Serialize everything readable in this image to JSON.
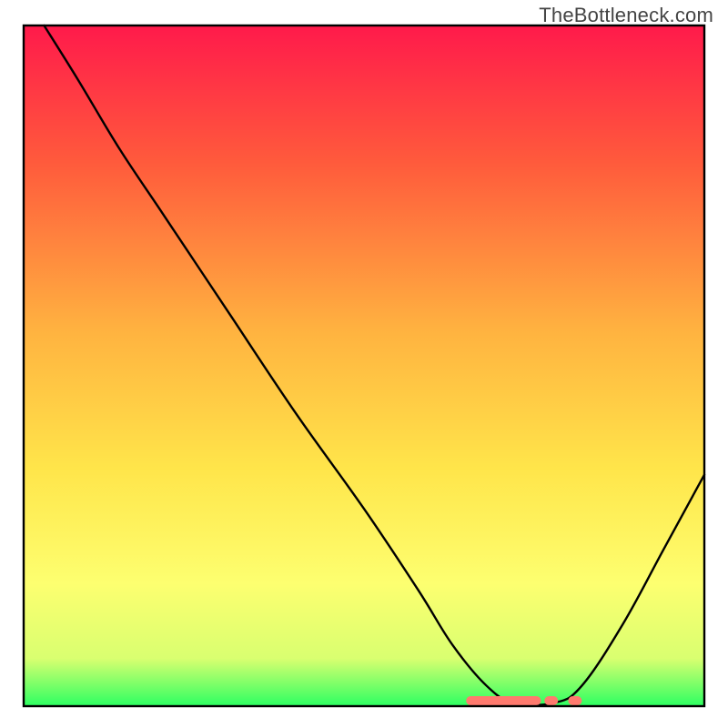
{
  "watermark": "TheBottleneck.com",
  "chart_data": {
    "type": "line",
    "title": "",
    "xlabel": "",
    "ylabel": "",
    "xlim": [
      0,
      100
    ],
    "ylim": [
      0,
      100
    ],
    "gradient_stops": [
      {
        "offset": 0.0,
        "color": "#ff1a4b"
      },
      {
        "offset": 0.2,
        "color": "#ff5a3c"
      },
      {
        "offset": 0.45,
        "color": "#ffb340"
      },
      {
        "offset": 0.65,
        "color": "#ffe54a"
      },
      {
        "offset": 0.82,
        "color": "#fdff70"
      },
      {
        "offset": 0.93,
        "color": "#d9ff70"
      },
      {
        "offset": 1.0,
        "color": "#2dff62"
      }
    ],
    "series": [
      {
        "name": "curve",
        "points": [
          {
            "x": 3.0,
            "y": 100.0
          },
          {
            "x": 8.0,
            "y": 92.0
          },
          {
            "x": 14.0,
            "y": 82.0
          },
          {
            "x": 20.0,
            "y": 73.0
          },
          {
            "x": 24.0,
            "y": 67.0
          },
          {
            "x": 30.0,
            "y": 58.0
          },
          {
            "x": 40.0,
            "y": 43.0
          },
          {
            "x": 50.0,
            "y": 29.0
          },
          {
            "x": 58.0,
            "y": 17.0
          },
          {
            "x": 63.0,
            "y": 9.0
          },
          {
            "x": 68.0,
            "y": 3.0
          },
          {
            "x": 72.0,
            "y": 0.5
          },
          {
            "x": 78.0,
            "y": 0.5
          },
          {
            "x": 82.0,
            "y": 3.0
          },
          {
            "x": 88.0,
            "y": 12.0
          },
          {
            "x": 94.0,
            "y": 23.0
          },
          {
            "x": 100.0,
            "y": 34.0
          }
        ]
      }
    ],
    "flat_band": {
      "x_start": 65,
      "x_end": 82,
      "color": "#ff7a6e",
      "segments": [
        {
          "x0": 65,
          "x1": 76
        },
        {
          "x0": 76.5,
          "x1": 78.5
        },
        {
          "x0": 80,
          "x1": 82
        }
      ]
    }
  }
}
